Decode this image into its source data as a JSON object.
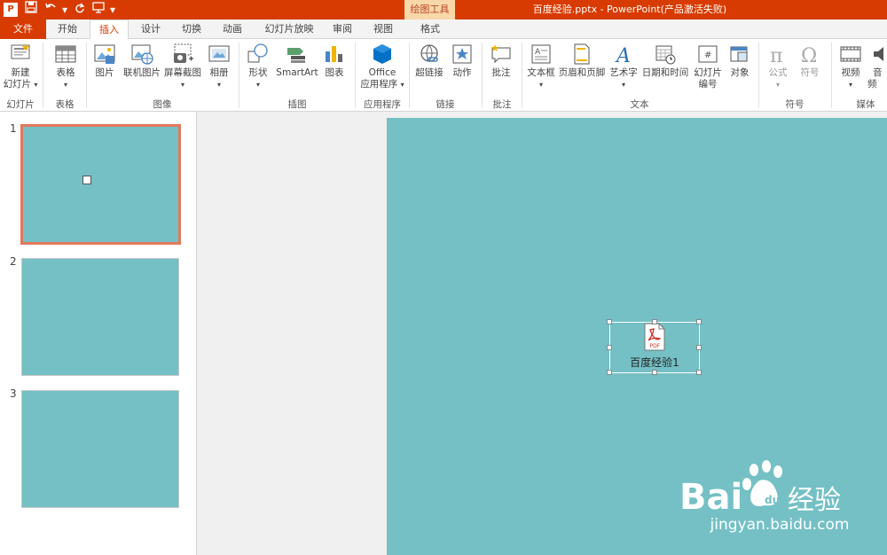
{
  "titlebar": {
    "app_logo": "P",
    "qat_icons": [
      "save-icon",
      "undo-icon",
      "redo-icon",
      "start-from-beginning-icon"
    ],
    "context_tool": "绘图工具",
    "document_title": "百度经验.pptx -  PowerPoint(产品激活失败)"
  },
  "tabs": {
    "file": "文件",
    "home": "开始",
    "insert": "插入",
    "design": "设计",
    "transitions": "切换",
    "animations": "动画",
    "slideshow": "幻灯片放映",
    "review": "审阅",
    "view": "视图",
    "format": "格式"
  },
  "ribbon": {
    "new_slide_line1": "新建",
    "new_slide_line2": "幻灯片",
    "table": "表格",
    "pictures": "图片",
    "online_pictures": "联机图片",
    "screenshot": "屏幕截图",
    "photo_album": "相册",
    "shapes": "形状",
    "smartart": "SmartArt",
    "chart": "图表",
    "apps_line1": "Office",
    "apps_line2": "应用程序",
    "hyperlink": "超链接",
    "action": "动作",
    "comment": "批注",
    "textbox": "文本框",
    "header_footer": "页眉和页脚",
    "wordart": "艺术字",
    "date_time": "日期和时间",
    "slide_number_line1": "幻灯片",
    "slide_number_line2": "编号",
    "object": "对象",
    "equation": "公式",
    "symbol": "符号",
    "video": "视频",
    "audio": "音频",
    "groups": {
      "slides": "幻灯片",
      "tables": "表格",
      "images": "图像",
      "illustrations": "插图",
      "apps": "应用程序",
      "links": "链接",
      "comments": "批注",
      "text": "文本",
      "symbols": "符号",
      "media": "媒体"
    }
  },
  "thumbnails": [
    "1",
    "2",
    "3"
  ],
  "slide": {
    "background": "#74c0c5",
    "object_icon_text": "PDF",
    "object_label": "百度经验1"
  },
  "watermark": {
    "brand": "Bai",
    "brand2": "经验",
    "url": "jingyan.baidu.com"
  }
}
